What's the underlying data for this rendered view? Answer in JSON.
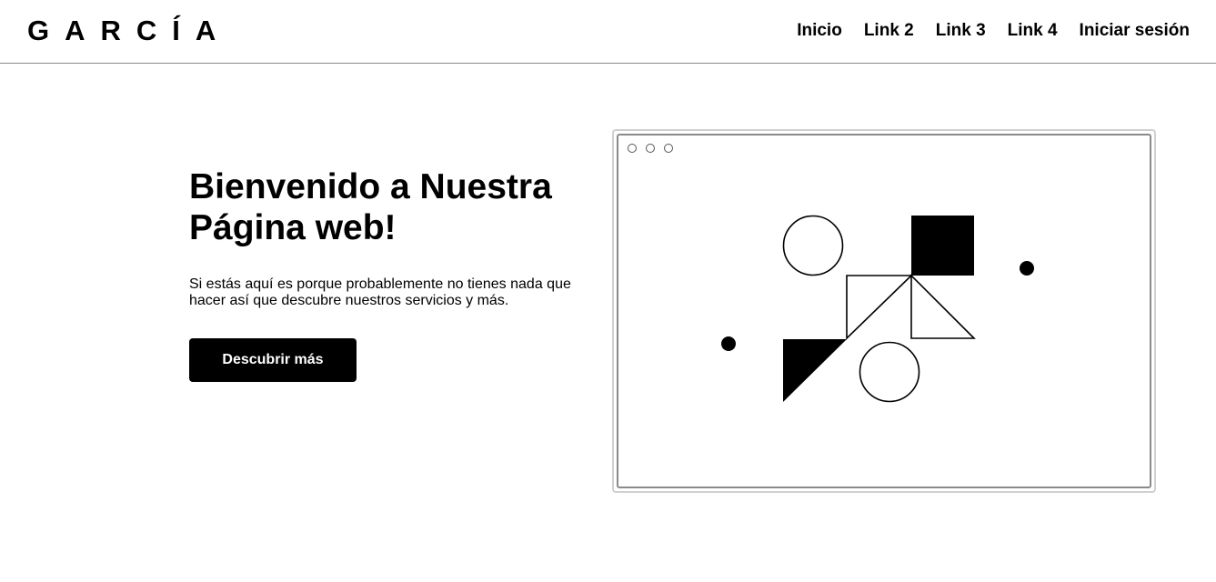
{
  "brand": {
    "name": "GARCÍA"
  },
  "nav": {
    "links": [
      "Inicio",
      "Link 2",
      "Link 3",
      "Link 4",
      "Iniciar sesión"
    ]
  },
  "hero": {
    "title": "Bienvenido a Nuestra Página web!",
    "text": "Si estás aquí es porque probablemente no tienes nada que hacer así que descubre nuestros servicios y más.",
    "button_label": "Descubrir más"
  },
  "colors": {
    "text": "#000000",
    "button_bg": "#000000",
    "button_text": "#ffffff",
    "nav_border": "#8a8a8a",
    "frame_border": "#d0d0d0"
  },
  "icons": {
    "window_dots": [
      "window-dot-icon",
      "window-dot-icon",
      "window-dot-icon"
    ],
    "illustration": "geometric-shapes-illustration"
  }
}
